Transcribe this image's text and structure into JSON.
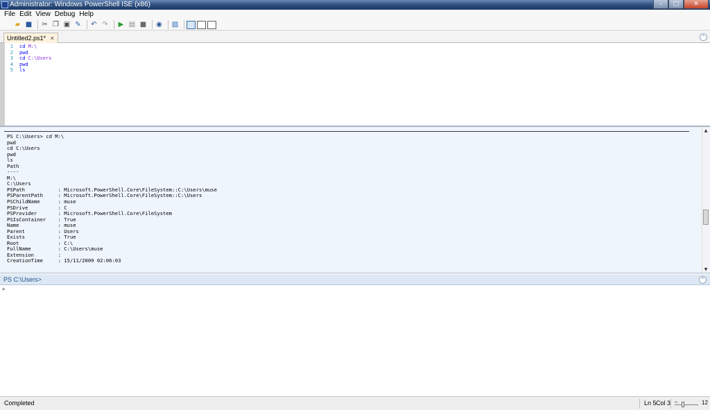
{
  "window": {
    "title": "Administrator: Windows PowerShell ISE (x86)",
    "minimize_glyph": "–",
    "maximize_glyph": "□",
    "close_glyph": "✕"
  },
  "menu": [
    "File",
    "Edit",
    "View",
    "Debug",
    "Help"
  ],
  "toolbar": {
    "icons": [
      {
        "name": "new-icon",
        "glyph": "□",
        "color": "#ffffff"
      },
      {
        "name": "open-icon",
        "glyph": "▰",
        "color": "#e0a82e"
      },
      {
        "name": "save-icon",
        "glyph": "■",
        "color": "#2b5a9e"
      },
      {
        "name": "cut-icon",
        "glyph": "✂",
        "color": "#4a4a4a"
      },
      {
        "name": "copy-icon",
        "glyph": "❐",
        "color": "#4a4a4a"
      },
      {
        "name": "paste-icon",
        "glyph": "▣",
        "color": "#4a4a4a"
      },
      {
        "name": "clear-icon",
        "glyph": "✎",
        "color": "#2d5ea8"
      },
      {
        "name": "undo-icon",
        "glyph": "↶",
        "color": "#2b5a9e"
      },
      {
        "name": "redo-icon",
        "glyph": "↷",
        "color": "#9a9a9a"
      },
      {
        "name": "run-icon",
        "glyph": "▶",
        "color": "#2a9a2a"
      },
      {
        "name": "run-selection-icon",
        "glyph": "▤",
        "color": "#8a8a8a"
      },
      {
        "name": "stop-icon",
        "glyph": "■",
        "color": "#6a6a6a"
      },
      {
        "name": "remote-icon",
        "glyph": "◉",
        "color": "#2b5a9e"
      },
      {
        "name": "powershell-icon",
        "glyph": "▨",
        "color": "#2d6fc0"
      }
    ]
  },
  "tab": {
    "label": "Untitled2.ps1*",
    "close_glyph": "✕"
  },
  "collapse_glyph": "⌃",
  "editor": {
    "line_numbers": [
      "1",
      "2",
      "3",
      "4",
      "5"
    ],
    "lines": [
      {
        "cmd": "cd",
        "arg": " M:\\"
      },
      {
        "cmd": "pwd",
        "arg": ""
      },
      {
        "cmd": "cd",
        "arg": " C:\\Users"
      },
      {
        "cmd": "pwd",
        "arg": ""
      },
      {
        "cmd": "ls",
        "arg": ""
      }
    ]
  },
  "output": {
    "lines": [
      "PS C:\\Users> cd M:\\",
      "pwd",
      "cd C:\\Users",
      "pwd",
      "ls",
      "",
      "Path",
      "----",
      "M:\\",
      "C:\\Users",
      "",
      "PSPath           : Microsoft.PowerShell.Core\\FileSystem::C:\\Users\\muse",
      "PSParentPath     : Microsoft.PowerShell.Core\\FileSystem::C:\\Users",
      "PSChildName      : muse",
      "PSDrive          : C",
      "PSProvider       : Microsoft.PowerShell.Core\\FileSystem",
      "PSIsContainer    : True",
      "Name             : muse",
      "Parent           : Users",
      "Exists           : True",
      "Root             : C:\\",
      "FullName         : C:\\Users\\muse",
      "Extension        :",
      "CreationTime     : 15/11/2009 02:06:03"
    ],
    "scroll_up_glyph": "▲",
    "scroll_down_glyph": "▼"
  },
  "command": {
    "prompt": "PS C:\\Users>",
    "caret": ">"
  },
  "status": {
    "text": "Completed",
    "ln": "Ln 5",
    "col": "Col 3",
    "zoom": "12",
    "zoom_minus": "–"
  }
}
